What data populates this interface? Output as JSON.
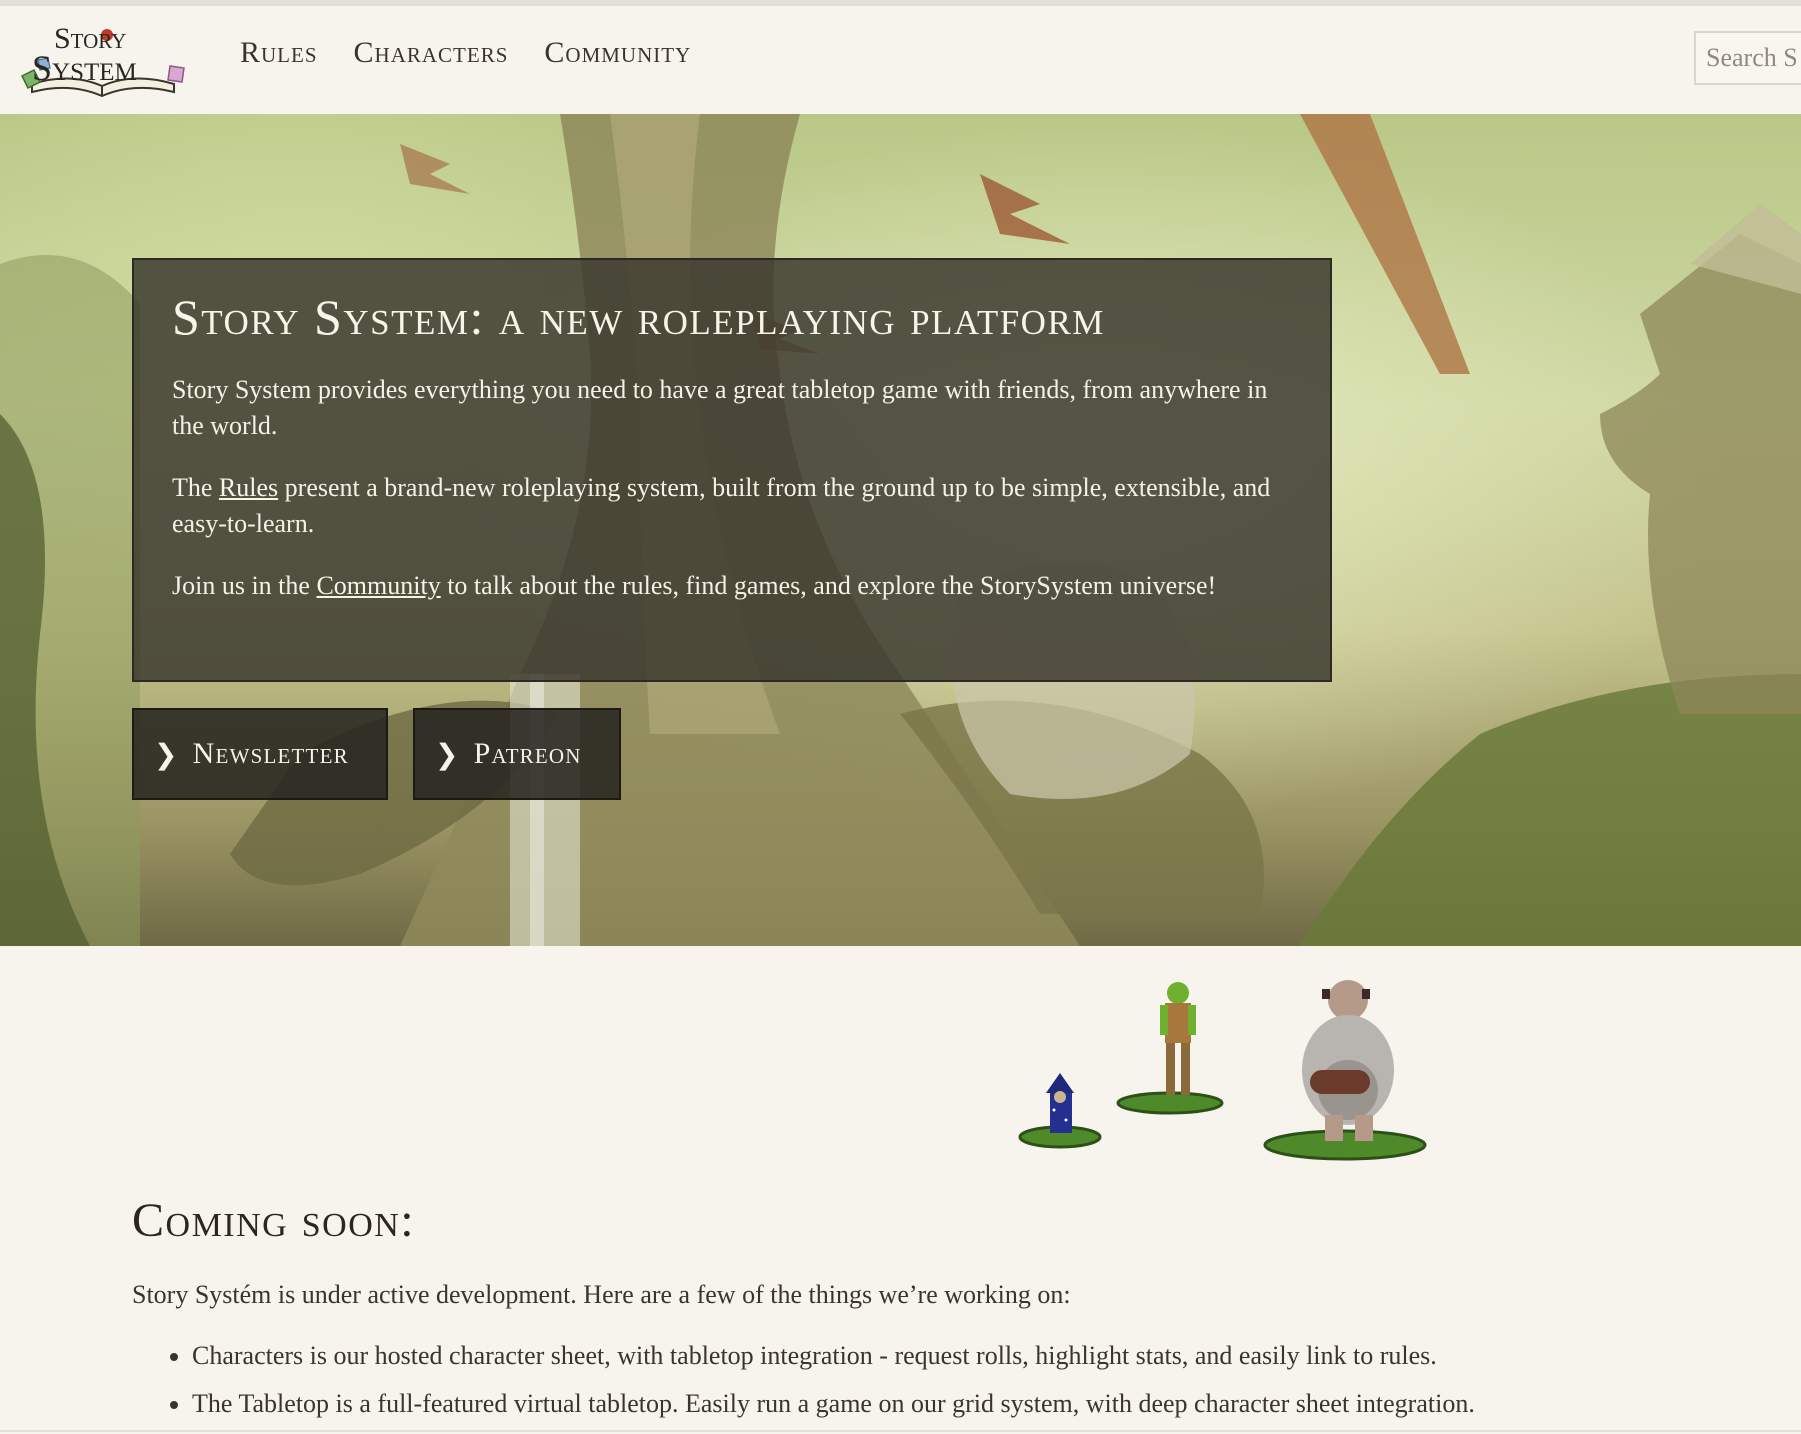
{
  "header": {
    "logo_line1": "Story",
    "logo_line2": "System",
    "nav": [
      "Rules",
      "Characters",
      "Community"
    ],
    "search_placeholder": "Search S"
  },
  "hero": {
    "title": "Story System: a new roleplaying platform",
    "p1": "Story System provides everything you need to have a great tabletop game with friends, from anywhere in the world.",
    "p2_before": "The ",
    "p2_link": "Rules",
    "p2_after": " present a brand-new roleplaying system, built from the ground up to be simple, extensible, and easy-to-learn.",
    "p3_before": "Join us in the ",
    "p3_link": "Community",
    "p3_after": " to talk about the rules, find games, and explore the StorySystem universe!",
    "buttons": [
      "Newsletter",
      "Patreon"
    ]
  },
  "coming": {
    "title": "Coming soon:",
    "intro": "Story Systém is under active development. Here are a few of the things we’re working on:",
    "items": [
      "Characters is our hosted character sheet, with tabletop integration - request rolls, highlight stats, and easily link to rules.",
      "The Tabletop is a full-featured virtual tabletop. Easily run a game on our grid system, with deep character sheet integration."
    ]
  },
  "colors": {
    "background": "#f6f4ec",
    "hero_box": "#3a382f",
    "text": "#2e2a22"
  },
  "icons": [
    "book-dice-logo",
    "chevron-right-icon",
    "wizard-sprite",
    "orc-sprite",
    "ogre-sprite"
  ]
}
